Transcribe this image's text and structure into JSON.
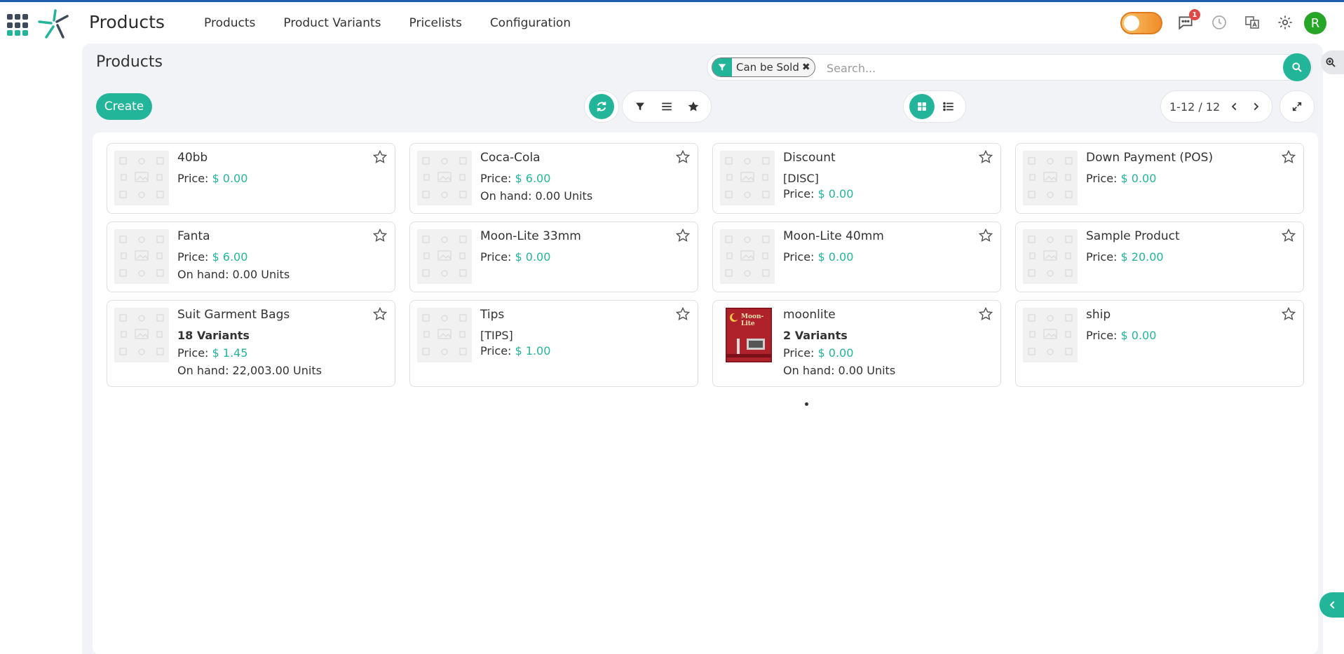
{
  "navbar": {
    "app_title": "Products",
    "menu": [
      "Products",
      "Product Variants",
      "Pricelists",
      "Configuration"
    ],
    "messages_count": "1",
    "user_initial": "R"
  },
  "control_panel": {
    "title": "Products",
    "facet_label": "Can be Sold",
    "search_placeholder": "Search...",
    "create_label": "Create",
    "pager": "1-12 / 12"
  },
  "products": [
    {
      "name": "40bb",
      "price_label": "Price:",
      "price": "$ 0.00"
    },
    {
      "name": "Coca-Cola",
      "price_label": "Price:",
      "price": "$ 6.00",
      "on_hand": "On hand: 0.00 Units"
    },
    {
      "name": "Discount",
      "code": "[DISC]",
      "price_label": "Price:",
      "price": "$ 0.00"
    },
    {
      "name": "Down Payment (POS)",
      "price_label": "Price:",
      "price": "$ 0.00"
    },
    {
      "name": "Fanta",
      "price_label": "Price:",
      "price": "$ 6.00",
      "on_hand": "On hand: 0.00 Units"
    },
    {
      "name": "Moon-Lite 33mm",
      "price_label": "Price:",
      "price": "$ 0.00"
    },
    {
      "name": "Moon-Lite 40mm",
      "price_label": "Price:",
      "price": "$ 0.00"
    },
    {
      "name": "Sample Product",
      "price_label": "Price:",
      "price": "$ 20.00"
    },
    {
      "name": "Suit Garment Bags",
      "variants": "18 Variants",
      "price_label": "Price:",
      "price": "$ 1.45",
      "on_hand": "On hand: 22,003.00 Units"
    },
    {
      "name": "Tips",
      "code": "[TIPS]",
      "price_label": "Price:",
      "price": "$ 1.00"
    },
    {
      "name": "moonlite",
      "variants": "2 Variants",
      "price_label": "Price:",
      "price": "$ 0.00",
      "on_hand": "On hand: 0.00 Units",
      "image_text": "Moon-Lite"
    },
    {
      "name": "ship",
      "price_label": "Price:",
      "price": "$ 0.00"
    }
  ],
  "colors": {
    "accent": "#23b59a",
    "top_line": "#1f5fae",
    "panel": "#f2f3f6",
    "badge": "#e04848",
    "avatar": "#26a526"
  }
}
